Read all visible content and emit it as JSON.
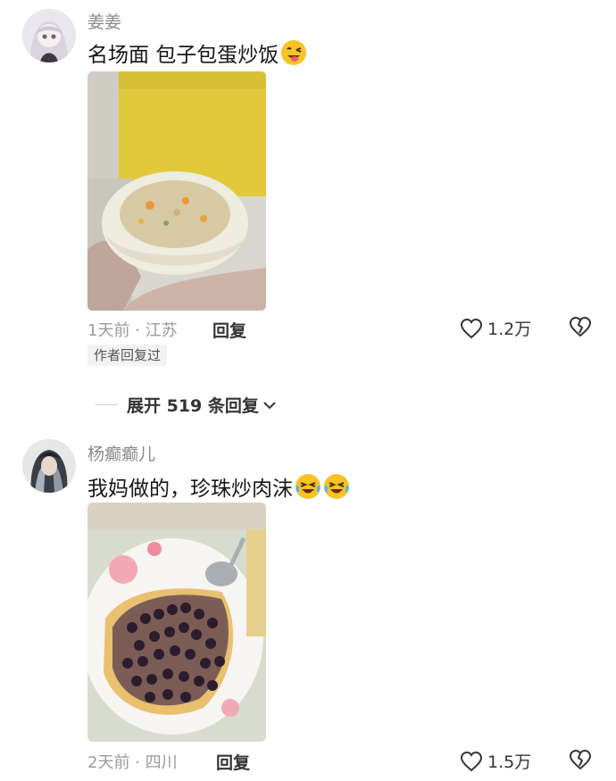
{
  "comments": [
    {
      "username": "姜姜",
      "text": "名场面 包子包蛋炒饭",
      "emoji": "winking-tongue-emoji",
      "photo": "steamed-bun-with-fried-rice-photo",
      "time_location": "1天前 · 江苏",
      "reply_label": "回复",
      "likes": "1.2万",
      "author_tag": "作者回复过"
    },
    {
      "username": "杨癫癫儿",
      "text": "我妈做的，珍珠炒肉沫",
      "emoji": "laughing-crying-emoji",
      "photo": "boba-stir-fried-minced-pork-photo",
      "time_location": "2天前 · 四川",
      "reply_label": "回复",
      "likes": "1.5万"
    }
  ],
  "expand_replies": "展开 519 条回复",
  "colors": {
    "meta_gray": "#9a9a9a",
    "text_dark": "#161616",
    "emoji_yellow": "#f7c325"
  }
}
